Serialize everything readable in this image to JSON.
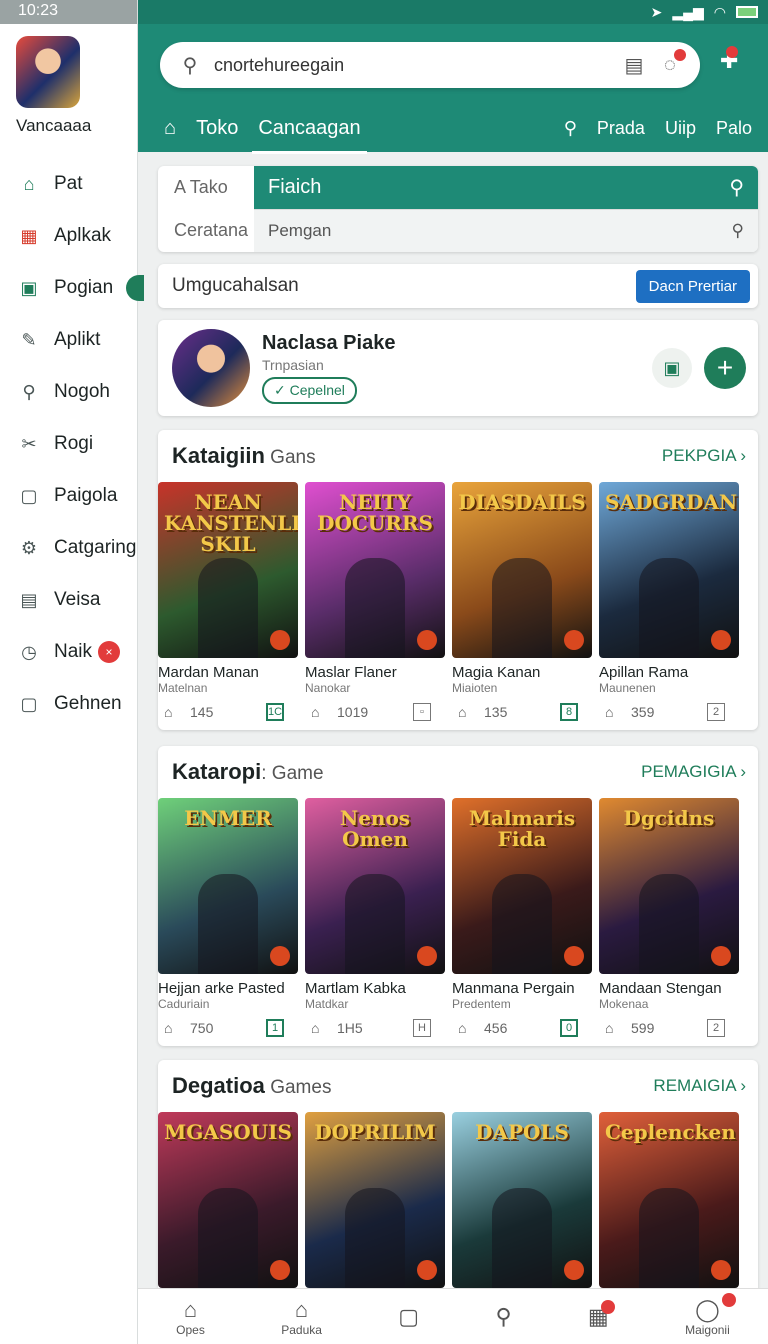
{
  "status": {
    "time": "10:23"
  },
  "sidebar": {
    "name": "Vancaaaa",
    "items": [
      {
        "label": "Pat",
        "icon": "home-icon"
      },
      {
        "label": "Aplkak",
        "icon": "apps-icon"
      },
      {
        "label": "Pogian",
        "icon": "chart-icon"
      },
      {
        "label": "Aplikt",
        "icon": "edit-icon"
      },
      {
        "label": "Nogoh",
        "icon": "search-icon"
      },
      {
        "label": "Rogi",
        "icon": "tag-icon"
      },
      {
        "label": "Paigola",
        "icon": "window-icon"
      },
      {
        "label": "Catgaring",
        "icon": "gear-icon"
      },
      {
        "label": "Veisa",
        "icon": "calendar-icon"
      },
      {
        "label": "Naik",
        "icon": "clock-icon",
        "badge": "×"
      },
      {
        "label": "Gehnen",
        "icon": "window-icon"
      }
    ]
  },
  "header": {
    "search_text": "cnortehureegain",
    "nav": {
      "t1": "Toko",
      "t2": "Cancaagan",
      "r1": "Prada",
      "r2": "Uiip",
      "r3": "Palo"
    }
  },
  "filter": {
    "row1_left": "A  Tako",
    "row1_right": "Fiaich",
    "row2_left": "Ceratana",
    "row2_right": "Pemgan"
  },
  "search2": {
    "label": "Umgucahalsan",
    "button": "Dacn Prertiar"
  },
  "profile": {
    "name": "Naclasa Piake",
    "sub": "Trnpasian",
    "chip": "Cepelnel"
  },
  "sections": [
    {
      "title_bold": "Kataigiin",
      "title_rest": " Gans",
      "link": "PEKPGIA",
      "tiles": [
        {
          "art": "NEAN KANSTENLIS SKIL",
          "name": "Mardan Manan",
          "sub": "Matelnan",
          "count": "145",
          "box": "1C",
          "colors": [
            "#2d5a2e",
            "#c8332a"
          ]
        },
        {
          "art": "NEITY DOCURRS",
          "name": "Maslar Flaner",
          "sub": "Nanokar",
          "count": "1019",
          "box": "▫",
          "colors": [
            "#5a2d6a",
            "#e04fd0"
          ]
        },
        {
          "art": "DIASDAILS",
          "name": "Magia Kanan",
          "sub": "Miaioten",
          "count": "135",
          "box": "8",
          "colors": [
            "#8a4a1a",
            "#e9a43b"
          ]
        },
        {
          "art": "SADGRDAN",
          "name": "Apillan Rama",
          "sub": "Maunenen",
          "count": "359",
          "box": "2",
          "colors": [
            "#1b2a3e",
            "#6fa8d8"
          ]
        }
      ]
    },
    {
      "title_bold": "Kataropi",
      "title_rest": ": Game",
      "link": "PEMAGIGIA",
      "tiles": [
        {
          "art": "ENMER",
          "name": "Hejjan arke Pasted",
          "sub": "Caduriain",
          "count": "750",
          "box": "1",
          "colors": [
            "#2a4a5a",
            "#6fd07a"
          ]
        },
        {
          "art": "Nenos Omen",
          "name": "Martlam Kabka",
          "sub": "Matdkar",
          "count": "1H5",
          "box": "H",
          "colors": [
            "#3a2050",
            "#e05fa0"
          ]
        },
        {
          "art": "Malmaris Fida",
          "name": "Manmana Pergain",
          "sub": "Predentem",
          "count": "456",
          "box": "0",
          "colors": [
            "#3a1a1a",
            "#e0702a"
          ]
        },
        {
          "art": "Dgcidns",
          "name": "Mandaan Stengan",
          "sub": "Mokenaa",
          "count": "599",
          "box": "2",
          "colors": [
            "#2a1a40",
            "#e08a30"
          ]
        }
      ]
    },
    {
      "title_bold": "Degatioa",
      "title_rest": " Games",
      "link": "REMAIGIA",
      "tiles": [
        {
          "art": "MGASOUIS",
          "name": "",
          "sub": "",
          "count": "",
          "box": "",
          "colors": [
            "#3a1a2a",
            "#c03a5a"
          ]
        },
        {
          "art": "DOPRILIM",
          "name": "",
          "sub": "",
          "count": "",
          "box": "",
          "colors": [
            "#1a2a4a",
            "#e0a040"
          ]
        },
        {
          "art": "DAPOLS",
          "name": "",
          "sub": "",
          "count": "",
          "box": "",
          "colors": [
            "#1a3a3a",
            "#9ad0e0"
          ]
        },
        {
          "art": "Ceplencken",
          "name": "",
          "sub": "",
          "count": "",
          "box": "",
          "colors": [
            "#4a1a1a",
            "#e0603a"
          ]
        }
      ]
    }
  ],
  "bottom": [
    {
      "label": "Opes",
      "icon": "home-icon"
    },
    {
      "label": "Paduka",
      "icon": "store-icon"
    },
    {
      "label": "",
      "icon": "square-icon"
    },
    {
      "label": "",
      "icon": "search-icon"
    },
    {
      "label": "",
      "icon": "library-icon",
      "badge": true
    },
    {
      "label": "Maigonii",
      "icon": "profile-icon",
      "badge": true
    }
  ]
}
